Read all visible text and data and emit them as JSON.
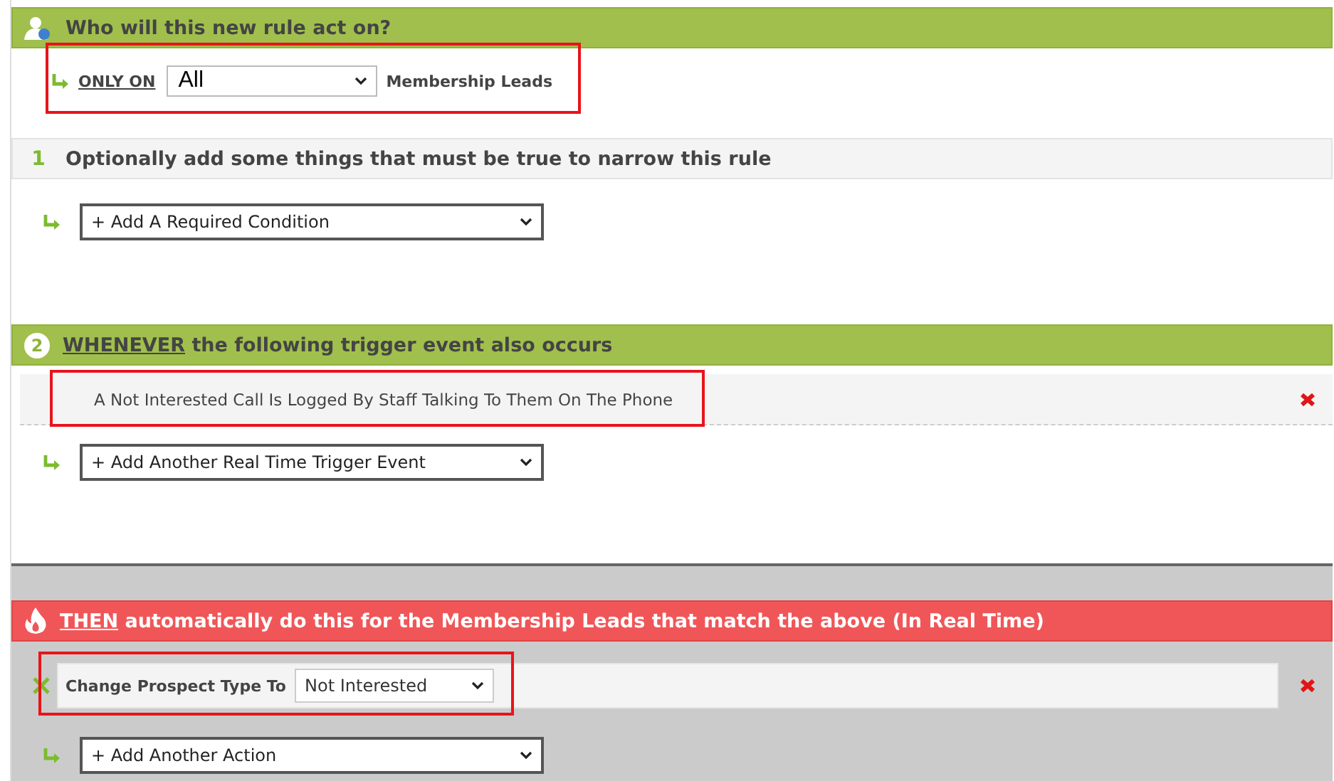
{
  "header": {
    "title": "Who will this new rule act on?"
  },
  "audience": {
    "link": "ONLY ON",
    "select": "All",
    "suffix": "Membership Leads",
    "highlighted": true
  },
  "step1": {
    "number": "1",
    "title": "Optionally add some things that must be true to narrow this rule",
    "add_select": "+ Add A Required Condition"
  },
  "step2": {
    "number": "2",
    "keyword": "WHENEVER",
    "title": "the following trigger event also occurs",
    "add_select": "+ Add Another Real Time Trigger Event",
    "triggers": [
      {
        "label": "A Not Interested Call Is Logged By Staff Talking To Them On The Phone",
        "highlighted": true
      }
    ]
  },
  "step3": {
    "keyword": "THEN",
    "title": "automatically do this for the Membership Leads that match the above (In Real Time)",
    "add_select": "+ Add Another Action",
    "actions": [
      {
        "label": "Change Prospect Type To",
        "value": "Not Interested",
        "highlighted": true
      }
    ]
  }
}
